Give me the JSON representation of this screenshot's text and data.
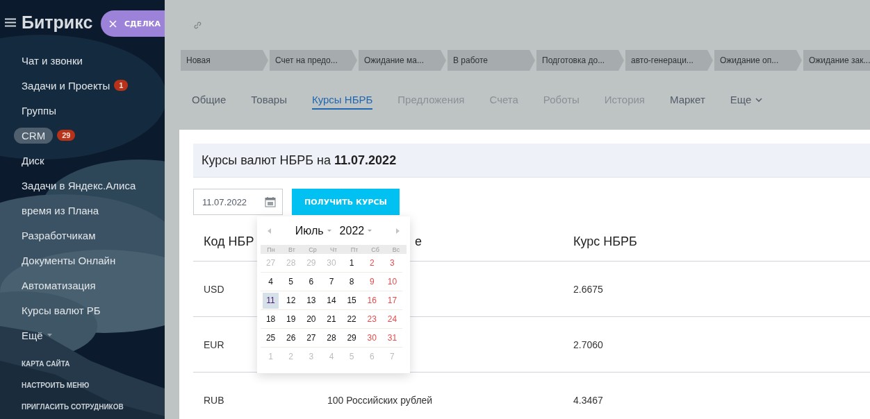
{
  "sidebar": {
    "logo": "Битрикс",
    "items": [
      {
        "label": "Чат и звонки",
        "selected": false
      },
      {
        "label": "Задачи и Проекты",
        "selected": false,
        "counter": "1"
      },
      {
        "label": "Группы",
        "selected": false
      },
      {
        "label": "CRM",
        "selected": true,
        "counter": "29"
      },
      {
        "label": "Диск",
        "selected": false
      },
      {
        "label": "Задачи в Яндекс.Алиса",
        "selected": false
      },
      {
        "label": "время из Плана",
        "selected": false
      },
      {
        "label": "Разработчикам",
        "selected": false
      },
      {
        "label": "Документы Онлайн",
        "selected": false
      },
      {
        "label": "Автоматизация",
        "selected": false
      },
      {
        "label": "Курсы валют РБ",
        "selected": false
      }
    ],
    "more": "Ещё",
    "footer_links": [
      "КАРТА САЙТА",
      "НАСТРОИТЬ МЕНЮ",
      "ПРИГЛАСИТЬ СОТРУДНИКОВ"
    ]
  },
  "close_pill": {
    "label": "СДЕЛКА"
  },
  "stages": [
    "Новая",
    "Счет на предо...",
    "Ожидание ма...",
    "В работе",
    "Подготовка до...",
    "авто-генераци...",
    "Ожидание оп...",
    "Ожидание зак..."
  ],
  "tabs": [
    {
      "label": "Общие",
      "selected": false,
      "disabled": false
    },
    {
      "label": "Товары",
      "selected": false,
      "disabled": false
    },
    {
      "label": "Курсы НБРБ",
      "selected": true,
      "disabled": false
    },
    {
      "label": "Предложения",
      "selected": false,
      "disabled": true
    },
    {
      "label": "Счета",
      "selected": false,
      "disabled": true
    },
    {
      "label": "Роботы",
      "selected": false,
      "disabled": true
    },
    {
      "label": "История",
      "selected": false,
      "disabled": true
    },
    {
      "label": "Маркет",
      "selected": false,
      "disabled": false
    },
    {
      "label": "Еще",
      "selected": false,
      "disabled": false,
      "dropdown": true
    }
  ],
  "panel": {
    "title": "Курсы валют НБРБ на **11.07.2022**",
    "date_field": {
      "value": "11.07.2022"
    },
    "button": "ПОЛУЧИТЬ КУРСЫ",
    "table": {
      "columns": [
        "Код НБР",
        "е",
        "Курс НБРБ"
      ],
      "rows": [
        [
          "USD",
          "",
          "2.6675"
        ],
        [
          "EUR",
          "",
          "2.7060"
        ],
        [
          "RUB",
          "100 Российских рублей",
          "4.3467"
        ]
      ]
    }
  },
  "calendar": {
    "month": "Июль",
    "year": "2022",
    "weekdays": [
      "Пн",
      "Вт",
      "Ср",
      "Чт",
      "Пт",
      "Сб",
      "Вс"
    ],
    "weeks": [
      [
        {
          "day": "27",
          "kind": "other",
          "selected": false
        },
        {
          "day": "28",
          "kind": "other",
          "selected": false
        },
        {
          "day": "29",
          "kind": "other",
          "selected": false
        },
        {
          "day": "30",
          "kind": "other",
          "selected": false
        },
        {
          "day": "1",
          "kind": "work",
          "selected": false
        },
        {
          "day": "2",
          "kind": "weekend",
          "selected": false
        },
        {
          "day": "3",
          "kind": "weekend",
          "selected": false
        }
      ],
      [
        {
          "day": "4",
          "kind": "work",
          "selected": false
        },
        {
          "day": "5",
          "kind": "work",
          "selected": false
        },
        {
          "day": "6",
          "kind": "work",
          "selected": false
        },
        {
          "day": "7",
          "kind": "work",
          "selected": false
        },
        {
          "day": "8",
          "kind": "work",
          "selected": false
        },
        {
          "day": "9",
          "kind": "weekend",
          "selected": false
        },
        {
          "day": "10",
          "kind": "weekend",
          "selected": false
        }
      ],
      [
        {
          "day": "11",
          "kind": "work",
          "selected": true
        },
        {
          "day": "12",
          "kind": "work",
          "selected": false
        },
        {
          "day": "13",
          "kind": "work",
          "selected": false
        },
        {
          "day": "14",
          "kind": "work",
          "selected": false
        },
        {
          "day": "15",
          "kind": "work",
          "selected": false
        },
        {
          "day": "16",
          "kind": "weekend",
          "selected": false
        },
        {
          "day": "17",
          "kind": "weekend",
          "selected": false
        }
      ],
      [
        {
          "day": "18",
          "kind": "work",
          "selected": false
        },
        {
          "day": "19",
          "kind": "work",
          "selected": false
        },
        {
          "day": "20",
          "kind": "work",
          "selected": false
        },
        {
          "day": "21",
          "kind": "work",
          "selected": false
        },
        {
          "day": "22",
          "kind": "work",
          "selected": false
        },
        {
          "day": "23",
          "kind": "weekend",
          "selected": false
        },
        {
          "day": "24",
          "kind": "weekend",
          "selected": false
        }
      ],
      [
        {
          "day": "25",
          "kind": "work",
          "selected": false
        },
        {
          "day": "26",
          "kind": "work",
          "selected": false
        },
        {
          "day": "27",
          "kind": "work",
          "selected": false
        },
        {
          "day": "28",
          "kind": "work",
          "selected": false
        },
        {
          "day": "29",
          "kind": "work",
          "selected": false
        },
        {
          "day": "30",
          "kind": "weekend",
          "selected": false
        },
        {
          "day": "31",
          "kind": "weekend",
          "selected": false
        }
      ],
      [
        {
          "day": "1",
          "kind": "other",
          "selected": false
        },
        {
          "day": "2",
          "kind": "other",
          "selected": false
        },
        {
          "day": "3",
          "kind": "other",
          "selected": false
        },
        {
          "day": "4",
          "kind": "other",
          "selected": false
        },
        {
          "day": "5",
          "kind": "other",
          "selected": false
        },
        {
          "day": "6",
          "kind": "other",
          "selected": false
        },
        {
          "day": "7",
          "kind": "other",
          "selected": false
        }
      ]
    ]
  }
}
